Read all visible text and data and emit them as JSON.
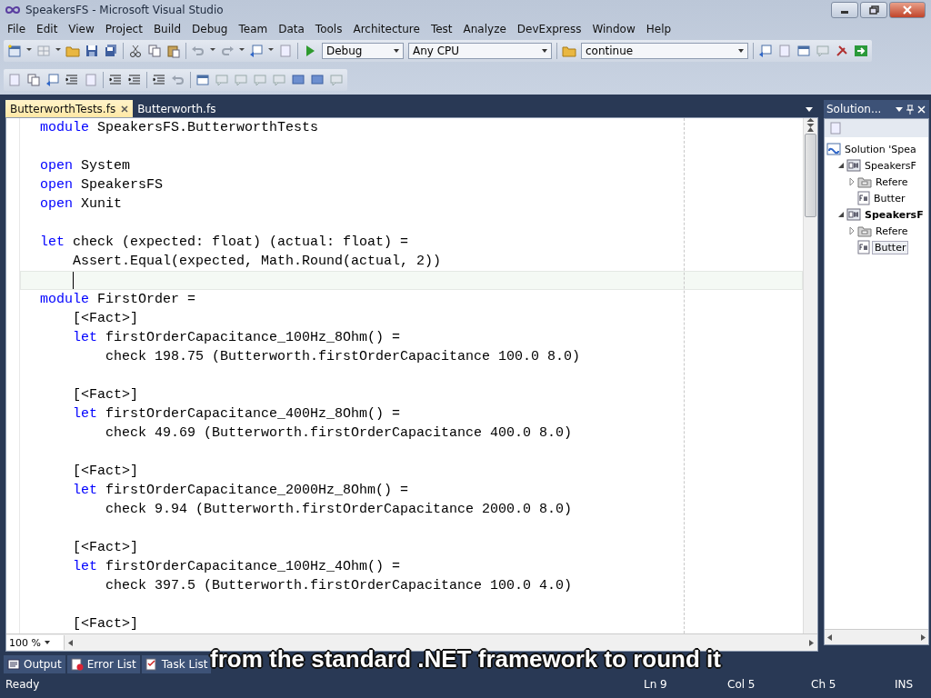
{
  "window": {
    "title": "SpeakersFS - Microsoft Visual Studio"
  },
  "menu": [
    "File",
    "Edit",
    "View",
    "Project",
    "Build",
    "Debug",
    "Team",
    "Data",
    "Tools",
    "Architecture",
    "Test",
    "Analyze",
    "DevExpress",
    "Window",
    "Help"
  ],
  "toolbar": {
    "configuration": "Debug",
    "platform": "Any CPU",
    "find": "continue"
  },
  "tabs": [
    {
      "label": "ButterworthTests.fs",
      "selected": true
    },
    {
      "label": "Butterworth.fs",
      "selected": false
    }
  ],
  "editor": {
    "lines": [
      {
        "kind": "code",
        "segments": [
          {
            "kind": "keyword",
            "text": "module"
          },
          {
            "kind": "plain",
            "text": " SpeakersFS.ButterworthTests"
          }
        ]
      },
      {
        "kind": "blank"
      },
      {
        "kind": "code",
        "segments": [
          {
            "kind": "keyword",
            "text": "open"
          },
          {
            "kind": "plain",
            "text": " System"
          }
        ]
      },
      {
        "kind": "code",
        "segments": [
          {
            "kind": "keyword",
            "text": "open"
          },
          {
            "kind": "plain",
            "text": " SpeakersFS"
          }
        ]
      },
      {
        "kind": "code",
        "segments": [
          {
            "kind": "keyword",
            "text": "open"
          },
          {
            "kind": "plain",
            "text": " Xunit"
          }
        ]
      },
      {
        "kind": "blank"
      },
      {
        "kind": "code",
        "segments": [
          {
            "kind": "keyword",
            "text": "let"
          },
          {
            "kind": "plain",
            "text": " check (expected: float) (actual: float) ="
          }
        ]
      },
      {
        "kind": "code",
        "segments": [
          {
            "kind": "plain",
            "text": "    Assert.Equal(expected, Math.Round(actual, 2))"
          }
        ]
      },
      {
        "kind": "current"
      },
      {
        "kind": "code",
        "segments": [
          {
            "kind": "keyword",
            "text": "module"
          },
          {
            "kind": "plain",
            "text": " FirstOrder ="
          }
        ]
      },
      {
        "kind": "code",
        "segments": [
          {
            "kind": "plain",
            "text": "    [<Fact>]"
          }
        ]
      },
      {
        "kind": "code",
        "segments": [
          {
            "kind": "keyword",
            "text": "    let"
          },
          {
            "kind": "plain",
            "text": " firstOrderCapacitance_100Hz_8Ohm() ="
          }
        ]
      },
      {
        "kind": "code",
        "segments": [
          {
            "kind": "plain",
            "text": "        check 198.75 (Butterworth.firstOrderCapacitance 100.0 8.0)"
          }
        ]
      },
      {
        "kind": "blank"
      },
      {
        "kind": "code",
        "segments": [
          {
            "kind": "plain",
            "text": "    [<Fact>]"
          }
        ]
      },
      {
        "kind": "code",
        "segments": [
          {
            "kind": "keyword",
            "text": "    let"
          },
          {
            "kind": "plain",
            "text": " firstOrderCapacitance_400Hz_8Ohm() ="
          }
        ]
      },
      {
        "kind": "code",
        "segments": [
          {
            "kind": "plain",
            "text": "        check 49.69 (Butterworth.firstOrderCapacitance 400.0 8.0)"
          }
        ]
      },
      {
        "kind": "blank"
      },
      {
        "kind": "code",
        "segments": [
          {
            "kind": "plain",
            "text": "    [<Fact>]"
          }
        ]
      },
      {
        "kind": "code",
        "segments": [
          {
            "kind": "keyword",
            "text": "    let"
          },
          {
            "kind": "plain",
            "text": " firstOrderCapacitance_2000Hz_8Ohm() ="
          }
        ]
      },
      {
        "kind": "code",
        "segments": [
          {
            "kind": "plain",
            "text": "        check 9.94 (Butterworth.firstOrderCapacitance 2000.0 8.0)"
          }
        ]
      },
      {
        "kind": "blank"
      },
      {
        "kind": "code",
        "segments": [
          {
            "kind": "plain",
            "text": "    [<Fact>]"
          }
        ]
      },
      {
        "kind": "code",
        "segments": [
          {
            "kind": "keyword",
            "text": "    let"
          },
          {
            "kind": "plain",
            "text": " firstOrderCapacitance_100Hz_4Ohm() ="
          }
        ]
      },
      {
        "kind": "code",
        "segments": [
          {
            "kind": "plain",
            "text": "        check 397.5 (Butterworth.firstOrderCapacitance 100.0 4.0)"
          }
        ]
      },
      {
        "kind": "blank"
      },
      {
        "kind": "code",
        "segments": [
          {
            "kind": "plain",
            "text": "    [<Fact>]"
          }
        ]
      }
    ],
    "zoom": "100 %"
  },
  "solution_explorer": {
    "title": "Solution...",
    "tree": [
      {
        "label": "Solution 'Spea",
        "kind": "solution",
        "expanded": true,
        "startup": false,
        "selected": false,
        "children": [
          {
            "label": "SpeakersF",
            "kind": "project",
            "expanded": true,
            "startup": false,
            "selected": false,
            "children": [
              {
                "label": "Refere",
                "kind": "references",
                "expanded": false,
                "startup": false,
                "selected": false
              },
              {
                "label": "Butter",
                "kind": "file",
                "startup": false,
                "selected": false
              }
            ]
          },
          {
            "label": "SpeakersF",
            "kind": "project",
            "expanded": true,
            "startup": true,
            "selected": false,
            "children": [
              {
                "label": "Refere",
                "kind": "references",
                "expanded": false,
                "startup": false,
                "selected": false
              },
              {
                "label": "Butter",
                "kind": "file",
                "startup": false,
                "selected": true
              }
            ]
          }
        ]
      }
    ]
  },
  "tool_tabs": [
    "Output",
    "Error List",
    "Task List"
  ],
  "caption": "from the standard .NET framework to round it",
  "status_bar": {
    "message": "Ready",
    "line": "Ln 9",
    "column": "Col 5",
    "char": "Ch 5",
    "mode": "INS"
  }
}
